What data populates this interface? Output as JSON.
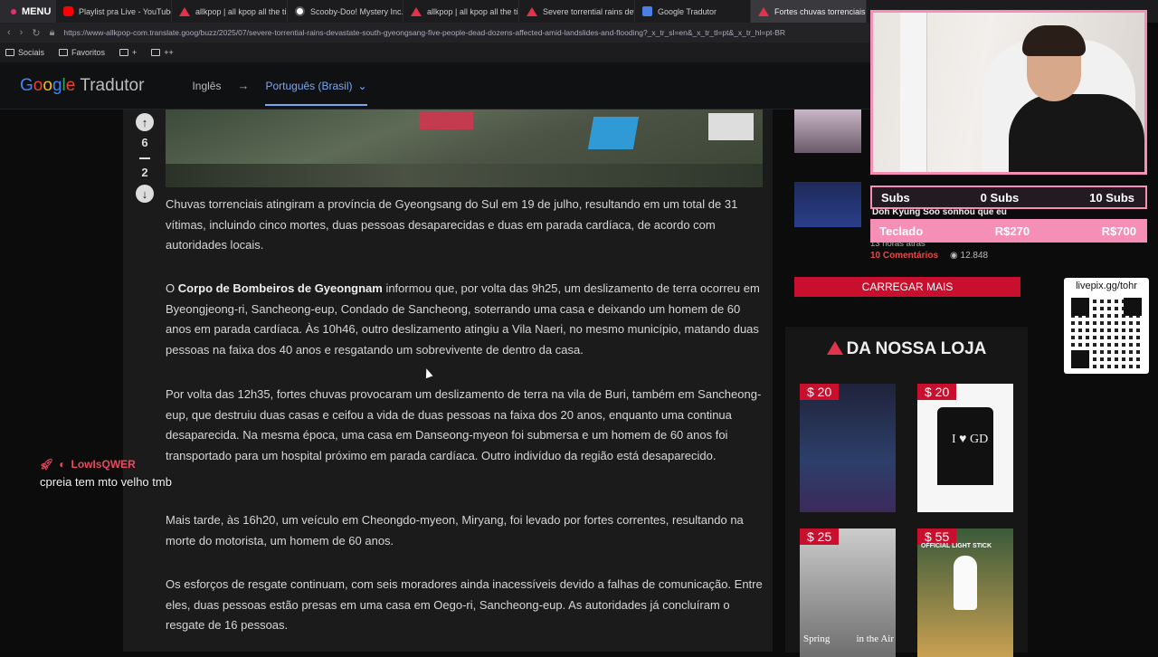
{
  "browser": {
    "menu_label": "MENU",
    "tabs": [
      {
        "title": "Playlist pra Live - YouTube",
        "icon": "youtube-icon"
      },
      {
        "title": "allkpop | all kpop all the time",
        "icon": "allkpop-icon"
      },
      {
        "title": "Scooby-Doo! Mystery Inc.",
        "icon": "scooby-icon"
      },
      {
        "title": "allkpop | all kpop all the time",
        "icon": "allkpop-icon"
      },
      {
        "title": "Severe torrential rains devastate",
        "icon": "allkpop-icon"
      },
      {
        "title": "Google Tradutor",
        "icon": "google-translate-icon"
      },
      {
        "title": "Fortes chuvas torrenciais",
        "icon": "allkpop-icon"
      }
    ],
    "url": "https://www-allkpop-com.translate.goog/buzz/2025/07/severe-torrential-rains-devastate-south-gyeongsang-five-people-dead-dozens-affected-amid-landslides-and-flooding?_x_tr_sl=en&_x_tr_tl=pt&_x_tr_hl=pt-BR",
    "bookmarks": [
      "Sociais",
      "Favoritos",
      "+",
      "++"
    ]
  },
  "translate_bar": {
    "logo_google": "Google",
    "logo_tradutor": "Tradutor",
    "source_lang": "Inglês",
    "arrow": "→",
    "target_lang": "Português (Brasil)"
  },
  "votes": {
    "up": "6",
    "down": "2"
  },
  "article": {
    "p1": "Chuvas torrenciais atingiram a província de Gyeongsang do Sul em 19 de julho, resultando em um total de 31 vítimas, incluindo cinco mortes, duas pessoas desaparecidas e duas em parada cardíaca, de acordo com autoridades locais.",
    "p2_lead": "O ",
    "p2_bold": "Corpo de Bombeiros de Gyeongnam",
    "p2_rest": " informou que, por volta das 9h25, um deslizamento de terra ocorreu em Byeongjeong-ri, Sancheong-eup, Condado de Sancheong, soterrando uma casa e deixando um homem de 60 anos em parada cardíaca. Às 10h46, outro deslizamento atingiu a Vila Naeri, no mesmo município, matando duas pessoas na faixa dos 40 anos e resgatando um sobrevivente de dentro da casa.",
    "p3": "Por volta das 12h35, fortes chuvas provocaram um deslizamento de terra na vila de Buri, também em Sancheong-eup, que destruiu duas casas e ceifou a vida de duas pessoas na faixa dos 20 anos, enquanto uma continua desaparecida. Na mesma época, uma casa em Danseong-myeon foi submersa e um homem de 60 anos foi transportado para um hospital próximo em parada cardíaca. Outro indivíduo da região está desaparecido.",
    "p4": "Mais tarde, às 16h20, um veículo em Cheongdo-myeon, Miryang, foi levado por fortes correntes, resultando na morte do motorista, um homem de 60 anos.",
    "p5": "Os esforços de resgate continuam, com seis moradores ainda inacessíveis devido a falhas de comunicação. Entre eles, duas pessoas estão presas em uma casa em Oego-ri, Sancheong-eup. As autoridades já concluíram o resgate de 16 pessoas."
  },
  "sidebar": {
    "overlay_headline": "Doh Kyung Soo sonhou que eu",
    "time_ago": "13 horas atrás",
    "comments": "10 Comentários",
    "views": "12.848",
    "load_more": "CARREGAR MAIS",
    "shop_title": "DA NOSSA LOJA",
    "products": [
      {
        "price": "$ 20"
      },
      {
        "price": "$ 20",
        "print": "I ♥ GD"
      },
      {
        "price": "$ 25",
        "caption_left": "Spring",
        "caption_right": "in the Air"
      },
      {
        "price": "$ 55",
        "caption": "OFFICIAL LIGHT STICK"
      }
    ]
  },
  "chat": {
    "username": "LowIsQWER",
    "message": "cpreia tem mto velho tmb"
  },
  "stream_overlay": {
    "subs_label": "Subs",
    "subs_current": "0 Subs",
    "subs_goal": "10 Subs",
    "goal2_label": "Teclado",
    "goal2_current": "R$270",
    "goal2_goal": "R$700",
    "qr_label": "livepix.gg/tohr"
  },
  "colors": {
    "accent_pink": "#f58fb5",
    "allkpop_red": "#c8102e",
    "translate_blue": "#7aa7f4"
  }
}
